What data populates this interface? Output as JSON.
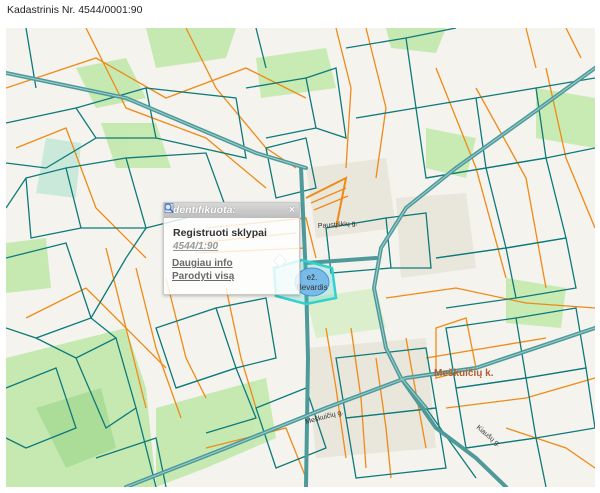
{
  "page": {
    "title": "Kadastrinis Nr. 4544/0001:90"
  },
  "map": {
    "labels": {
      "lake": [
        "ež.",
        "Bevardis"
      ],
      "village": "Meškuičių k.",
      "street_north": "Paustiškių g.",
      "street_southwest": "Meškuičių g.",
      "street_southeast": "Kiaušų g."
    },
    "colors": {
      "parcel": "#0e7a7a",
      "boundary": "#f08a16",
      "road": "#4e9a9a",
      "forest": "#bfe8a8",
      "water": "#8fb4f0",
      "highlight": "#33d0d0"
    }
  },
  "popup": {
    "title": "Identifikuota:",
    "close": "×",
    "layer": "Registruoti sklypai",
    "parcel_id": "4544/1:90",
    "more_info": "Daugiau info",
    "show_all": "Parodyti visą",
    "icons": [
      "info-doc-icon",
      "magnifier-icon"
    ]
  }
}
